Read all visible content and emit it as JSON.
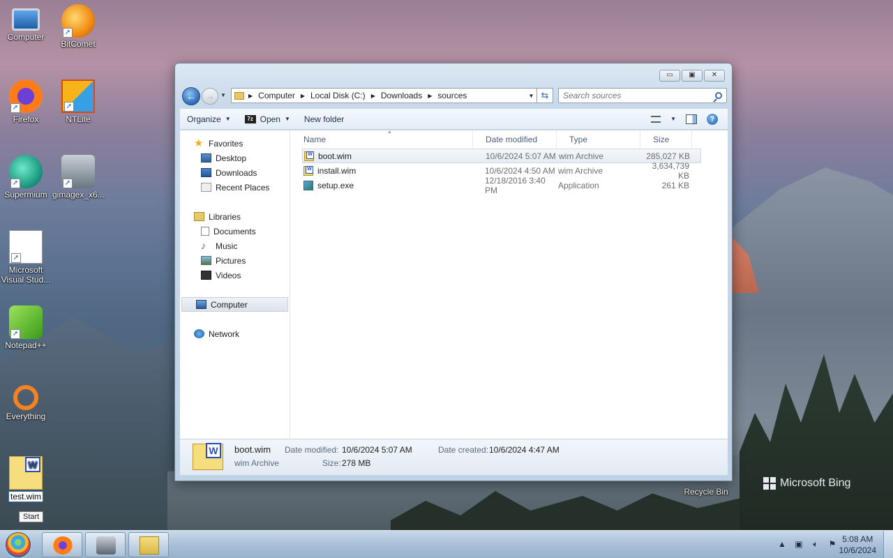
{
  "desktop": {
    "icons": [
      {
        "label": "Computer",
        "icon": "computer-icon"
      },
      {
        "label": "BitComet",
        "icon": "bitcomet-icon"
      },
      {
        "label": "Firefox",
        "icon": "firefox-icon"
      },
      {
        "label": "NTLite",
        "icon": "ntlite-icon"
      },
      {
        "label": "Supermium",
        "icon": "supermium-icon"
      },
      {
        "label": "gimagex_x6...",
        "icon": "gimagex-icon"
      },
      {
        "label": "Microsoft Visual Stud...",
        "icon": "visual-studio-icon"
      },
      {
        "label": "Notepad++",
        "icon": "notepad-plus-plus-icon"
      },
      {
        "label": "Everything",
        "icon": "everything-icon"
      },
      {
        "label": "test.wim",
        "icon": "wim-file-icon"
      },
      {
        "label": "Recycle Bin",
        "icon": "recycle-bin-icon"
      }
    ],
    "tooltip": "Start",
    "watermark": "Microsoft Bing"
  },
  "window": {
    "caption_buttons": {
      "minimize": "▭",
      "maximize": "▣",
      "close": "✕"
    },
    "address": {
      "segments": [
        "Computer",
        "Local Disk (C:)",
        "Downloads",
        "sources"
      ]
    },
    "search": {
      "placeholder": "Search sources"
    },
    "toolbar": {
      "organize": "Organize",
      "open": "Open",
      "seven_zip_badge": "7z",
      "new_folder": "New folder",
      "help": "?"
    },
    "nav": {
      "favorites": "Favorites",
      "favorites_items": [
        "Desktop",
        "Downloads",
        "Recent Places"
      ],
      "libraries": "Libraries",
      "libraries_items": [
        "Documents",
        "Music",
        "Pictures",
        "Videos"
      ],
      "computer": "Computer",
      "network": "Network"
    },
    "columns": {
      "name": "Name",
      "date": "Date modified",
      "type": "Type",
      "size": "Size"
    },
    "files": [
      {
        "name": "boot.wim",
        "date": "10/6/2024 5:07 AM",
        "type": "wim Archive",
        "size": "285,027 KB",
        "selected": true
      },
      {
        "name": "install.wim",
        "date": "10/6/2024 4:50 AM",
        "type": "wim Archive",
        "size": "3,634,739 KB",
        "selected": false
      },
      {
        "name": "setup.exe",
        "date": "12/18/2016 3:40 PM",
        "type": "Application",
        "size": "261 KB",
        "selected": false
      }
    ],
    "details": {
      "name": "boot.wim",
      "type": "wim Archive",
      "modified_label": "Date modified:",
      "modified_value": "10/6/2024 5:07 AM",
      "size_label": "Size:",
      "size_value": "278 MB",
      "created_label": "Date created:",
      "created_value": "10/6/2024 4:47 AM"
    }
  },
  "taskbar": {
    "clock_time": "5:08 AM",
    "clock_date": "10/6/2024",
    "tray_icons": [
      "show-hidden-icons",
      "network-icon",
      "volume-icon",
      "action-center-flag-icon"
    ]
  }
}
